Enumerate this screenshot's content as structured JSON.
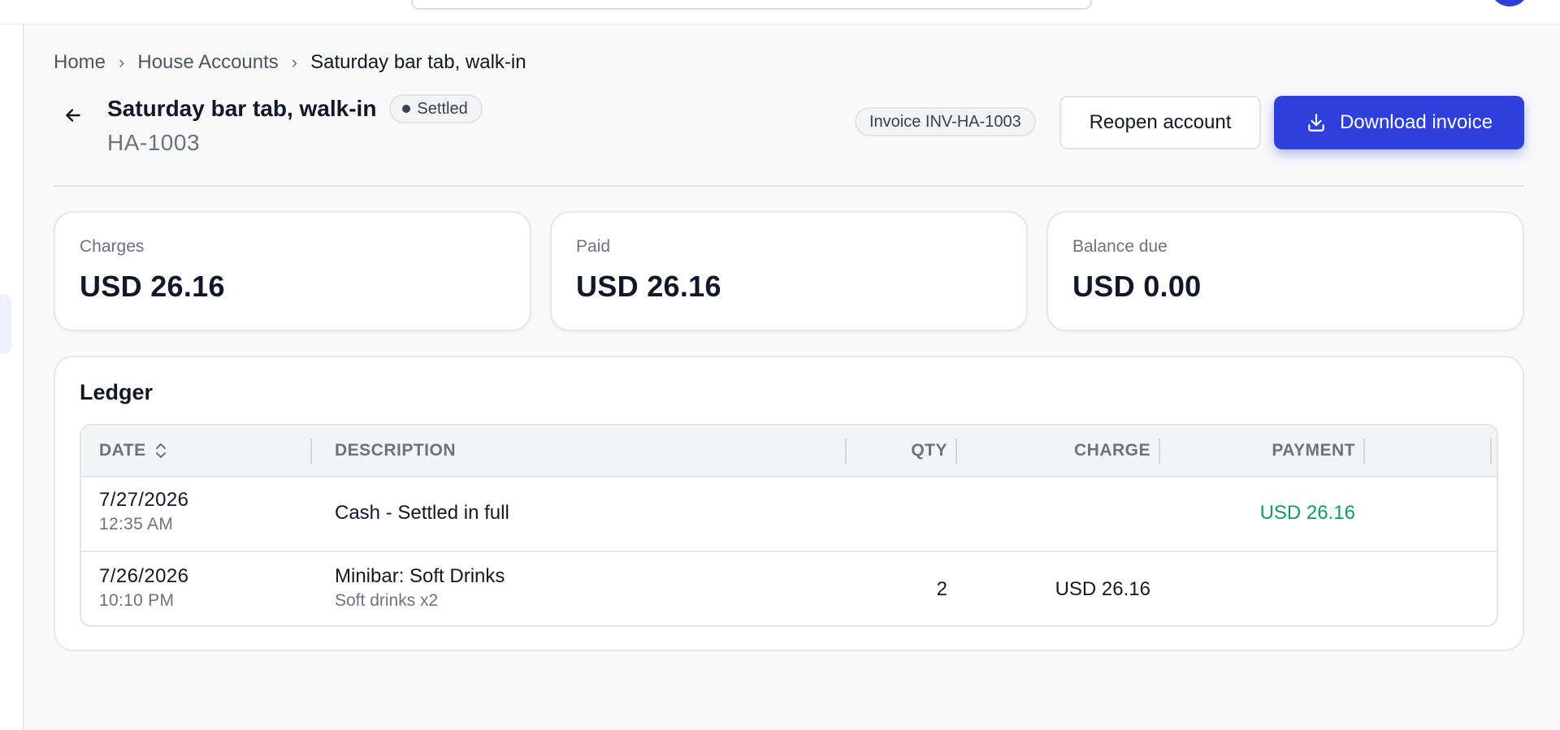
{
  "breadcrumb": {
    "items": [
      "Home",
      "House Accounts"
    ],
    "current": "Saturday bar tab, walk-in"
  },
  "header": {
    "title": "Saturday bar tab, walk-in",
    "status": "Settled",
    "account_code": "HA-1003",
    "invoice_chip": "Invoice INV-HA-1003",
    "reopen_label": "Reopen account",
    "download_label": "Download invoice"
  },
  "summary": {
    "charges": {
      "label": "Charges",
      "value": "USD 26.16"
    },
    "paid": {
      "label": "Paid",
      "value": "USD 26.16"
    },
    "balance": {
      "label": "Balance due",
      "value": "USD 0.00"
    }
  },
  "ledger": {
    "title": "Ledger",
    "columns": {
      "date": "DATE",
      "description": "DESCRIPTION",
      "qty": "QTY",
      "charge": "CHARGE",
      "payment": "PAYMENT"
    },
    "rows": [
      {
        "date": "7/27/2026",
        "time": "12:35 AM",
        "description": "Cash - Settled in full",
        "detail": "",
        "qty": "",
        "charge": "",
        "payment": "USD 26.16"
      },
      {
        "date": "7/26/2026",
        "time": "10:10 PM",
        "description": "Minibar: Soft Drinks",
        "detail": "Soft drinks x2",
        "qty": "2",
        "charge": "USD 26.16",
        "payment": ""
      }
    ]
  },
  "colors": {
    "primary": "#2f3fdc",
    "payment": "#0f9a6a"
  },
  "icons": [
    "chevron-right-icon",
    "arrow-left-icon",
    "download-icon",
    "sort-icon"
  ]
}
